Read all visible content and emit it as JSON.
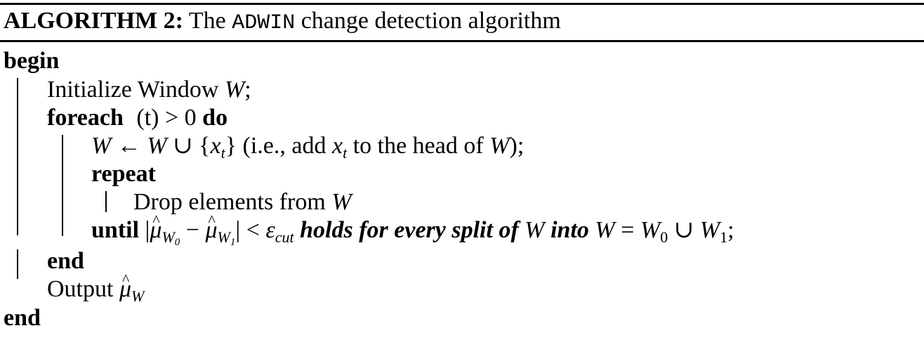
{
  "caption": {
    "label": "ALGORITHM 2:",
    "pre": "The",
    "name": "ADWIN",
    "post": "change detection algorithm"
  },
  "lines": {
    "begin": "begin",
    "init_text": "Initialize Window ",
    "init_var": "W",
    "init_end": ";",
    "foreach_kw": "foreach",
    "foreach_cond": "(t) > 0",
    "do_kw": "do",
    "assign_a": "W",
    "assign_b": " ← ",
    "assign_c": "W",
    "assign_d": " ∪ {",
    "assign_x": "x",
    "assign_xsub": "t",
    "assign_e": "} (i.e., add ",
    "assign_x2": "x",
    "assign_x2sub": "t",
    "assign_f": " to the head of ",
    "assign_w": "W",
    "assign_g": ");",
    "repeat_kw": "repeat",
    "drop_text": "Drop elements from ",
    "drop_var": "W",
    "until_kw": "until",
    "until_a": " |",
    "mu1": "μ",
    "mu1_sub": "W",
    "mu1_subsub": "0",
    "until_minus": " − ",
    "mu2": "μ",
    "mu2_sub": "W",
    "mu2_subsub": "1",
    "until_b": "| < ",
    "eps": "ε",
    "eps_sub": "cut",
    "until_holds": " holds for every split of ",
    "until_w": "W",
    "until_into": " into ",
    "until_eq_w": "W",
    "until_eq": " = ",
    "until_w0": "W",
    "until_w0sub": "0",
    "until_cup": " ∪ ",
    "until_w1": "W",
    "until_w1sub": "1",
    "until_end": ";",
    "end_inner": "end",
    "output_text": "Output ",
    "output_mu": "μ",
    "output_sub": "W",
    "end_outer": "end"
  }
}
